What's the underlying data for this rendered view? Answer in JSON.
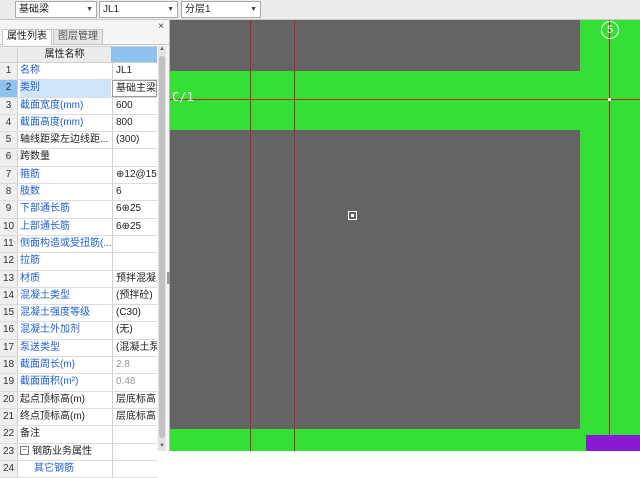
{
  "toolbar": {
    "combos": [
      {
        "value": "基础梁"
      },
      {
        "value": "JL1"
      },
      {
        "value": "分层1"
      }
    ]
  },
  "panel": {
    "tabs": [
      "属性列表",
      "图层管理"
    ],
    "header_name": "属性名称",
    "rows": [
      {
        "num": "1",
        "name": "名称",
        "value": "JL1",
        "style": "blue"
      },
      {
        "num": "2",
        "name": "类别",
        "value": "基础主梁",
        "style": "blue",
        "selected": true
      },
      {
        "num": "3",
        "name": "截面宽度(mm)",
        "value": "600",
        "style": "blue"
      },
      {
        "num": "4",
        "name": "截面高度(mm)",
        "value": "800",
        "style": "blue"
      },
      {
        "num": "5",
        "name": "轴线距梁左边线距...",
        "value": "(300)",
        "style": ""
      },
      {
        "num": "6",
        "name": "跨数量",
        "value": "",
        "style": ""
      },
      {
        "num": "7",
        "name": "箍筋",
        "value": "⊕12@15",
        "style": "blue"
      },
      {
        "num": "8",
        "name": "肢数",
        "value": "6",
        "style": "blue"
      },
      {
        "num": "9",
        "name": "下部通长筋",
        "value": "6⊕25",
        "style": "blue"
      },
      {
        "num": "10",
        "name": "上部通长筋",
        "value": "6⊕25",
        "style": "blue"
      },
      {
        "num": "11",
        "name": "侧面构造或受扭筋(...",
        "value": "",
        "style": "blue"
      },
      {
        "num": "12",
        "name": "拉筋",
        "value": "",
        "style": "blue"
      },
      {
        "num": "13",
        "name": "材质",
        "value": "预拌混凝土",
        "style": "blue"
      },
      {
        "num": "14",
        "name": "混凝土类型",
        "value": "(预拌砼)",
        "style": "blue"
      },
      {
        "num": "15",
        "name": "混凝土强度等级",
        "value": "(C30)",
        "style": "blue"
      },
      {
        "num": "16",
        "name": "混凝土外加剂",
        "value": "(无)",
        "style": "blue"
      },
      {
        "num": "17",
        "name": "泵送类型",
        "value": "(混凝土泵",
        "style": "blue"
      },
      {
        "num": "18",
        "name": "截面周长(m)",
        "value": "2.8",
        "style": "blue",
        "value_grey": true
      },
      {
        "num": "19",
        "name": "截面面积(m²)",
        "value": "0.48",
        "style": "blue",
        "value_grey": true
      },
      {
        "num": "20",
        "name": "起点顶标高(m)",
        "value": "层底标高",
        "style": ""
      },
      {
        "num": "21",
        "name": "终点顶标高(m)",
        "value": "层底标高",
        "style": ""
      },
      {
        "num": "22",
        "name": "备注",
        "value": "",
        "style": ""
      },
      {
        "num": "23",
        "name": "钢筋业务属性",
        "value": "",
        "style": "",
        "group": true
      },
      {
        "num": "24",
        "name": "其它钢筋",
        "value": "",
        "style": "blue",
        "indent": true
      }
    ]
  },
  "canvas": {
    "axis_label_c": "C/1",
    "axis_label_5": "5",
    "colors": {
      "beam": "#35e035",
      "slab": "#646464",
      "background": "#4b4b4b",
      "axis_line": "#b3232b",
      "selection": "#8a19d6"
    }
  }
}
